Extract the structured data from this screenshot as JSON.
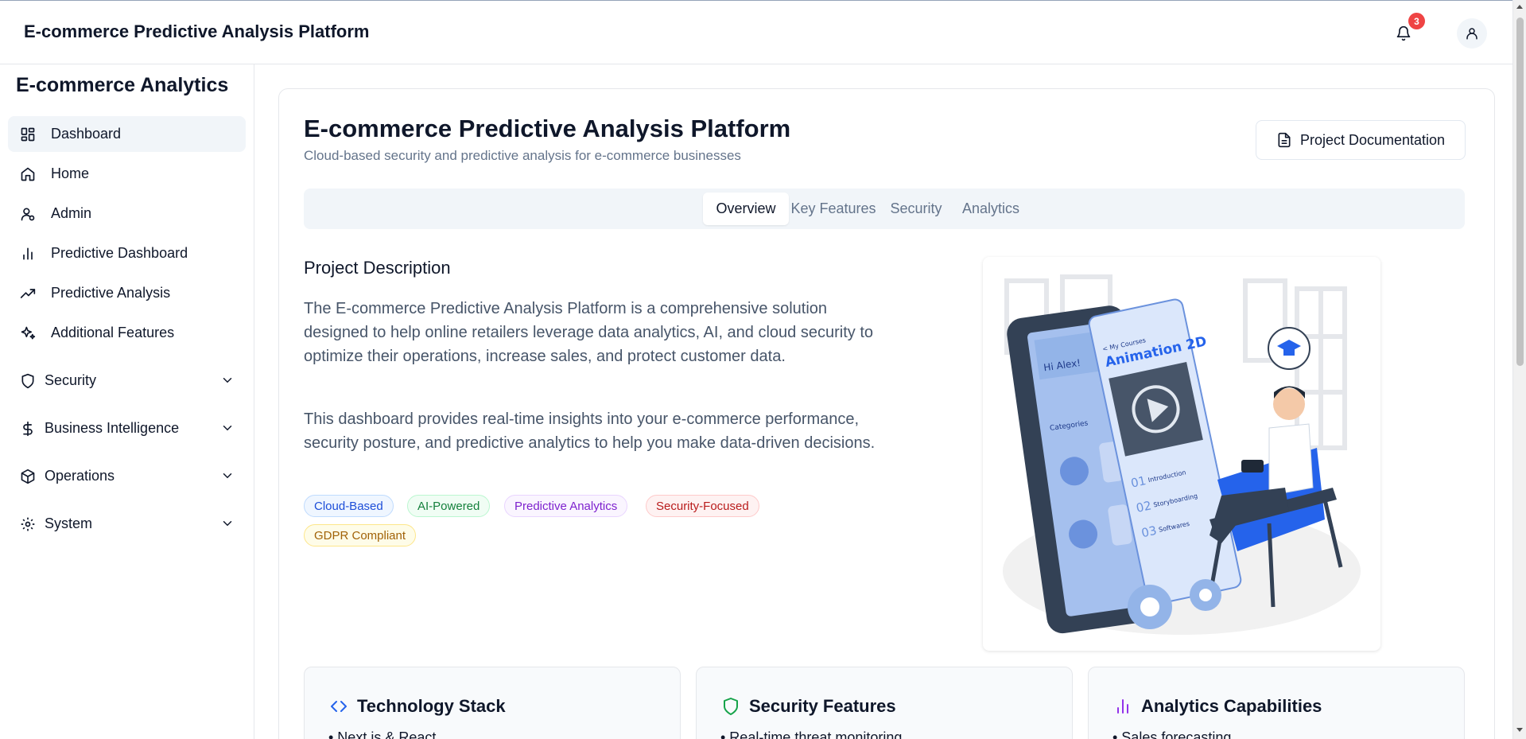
{
  "header": {
    "title": "E-commerce Predictive Analysis Platform",
    "notification_count": "3"
  },
  "sidebar": {
    "brand": "E-commerce Analytics",
    "items": [
      {
        "label": "Dashboard",
        "icon": "dashboard-icon",
        "active": true
      },
      {
        "label": "Home",
        "icon": "home-icon"
      },
      {
        "label": "Admin",
        "icon": "admin-user-icon"
      },
      {
        "label": "Predictive Dashboard",
        "icon": "bar-chart-icon"
      },
      {
        "label": "Predictive Analysis",
        "icon": "trending-up-icon"
      },
      {
        "label": "Additional Features",
        "icon": "sparkles-icon"
      }
    ],
    "groups": [
      {
        "label": "Security",
        "icon": "shield-icon"
      },
      {
        "label": "Business Intelligence",
        "icon": "dollar-icon"
      },
      {
        "label": "Operations",
        "icon": "package-icon"
      },
      {
        "label": "System",
        "icon": "gear-icon"
      }
    ]
  },
  "main": {
    "title": "E-commerce Predictive Analysis Platform",
    "subtitle": "Cloud-based security and predictive analysis for e-commerce businesses",
    "doc_button": "Project Documentation",
    "tabs": [
      {
        "label": "Overview",
        "active": true
      },
      {
        "label": "Key Features"
      },
      {
        "label": "Security"
      },
      {
        "label": "Analytics"
      }
    ],
    "section_title": "Project Description",
    "paragraphs": [
      "The E-commerce Predictive Analysis Platform is a comprehensive solution designed to help online retailers leverage data analytics, AI, and cloud security to optimize their operations, increase sales, and protect customer data.",
      "This dashboard provides real-time insights into your e-commerce performance, security posture, and predictive analytics to help you make data-driven decisions."
    ],
    "tags": [
      {
        "label": "Cloud-Based",
        "color": "#1d4ed8",
        "bg": "#eff6ff",
        "border": "#bfdbfe"
      },
      {
        "label": "AI-Powered",
        "color": "#15803d",
        "bg": "#f0fdf4",
        "border": "#bbf7d0"
      },
      {
        "label": "Predictive Analytics",
        "color": "#7e22ce",
        "bg": "#faf5ff",
        "border": "#e9d5ff"
      },
      {
        "label": "Security-Focused",
        "color": "#b91c1c",
        "bg": "#fef2f2",
        "border": "#fecaca"
      },
      {
        "label": "GDPR Compliant",
        "color": "#a16207",
        "bg": "#fefce8",
        "border": "#fde68a"
      }
    ],
    "illustration": {
      "phone_greeting": "Hi Alex!",
      "phone_section": "Categories",
      "course_header": "< My Courses",
      "course_title": "Animation 2D",
      "lessons": [
        {
          "num": "01",
          "title": "Introduction"
        },
        {
          "num": "02",
          "title": "Storyboarding"
        },
        {
          "num": "03",
          "title": "Softwares"
        }
      ]
    },
    "features": [
      {
        "title": "Technology Stack",
        "icon": "code-icon",
        "color": "#2563eb",
        "first_item": "• Next.js & React"
      },
      {
        "title": "Security Features",
        "icon": "shield-icon",
        "color": "#16a34a",
        "first_item": "• Real-time threat monitoring"
      },
      {
        "title": "Analytics Capabilities",
        "icon": "bar-chart-icon",
        "color": "#9333ea",
        "first_item": "• Sales forecasting"
      }
    ]
  }
}
